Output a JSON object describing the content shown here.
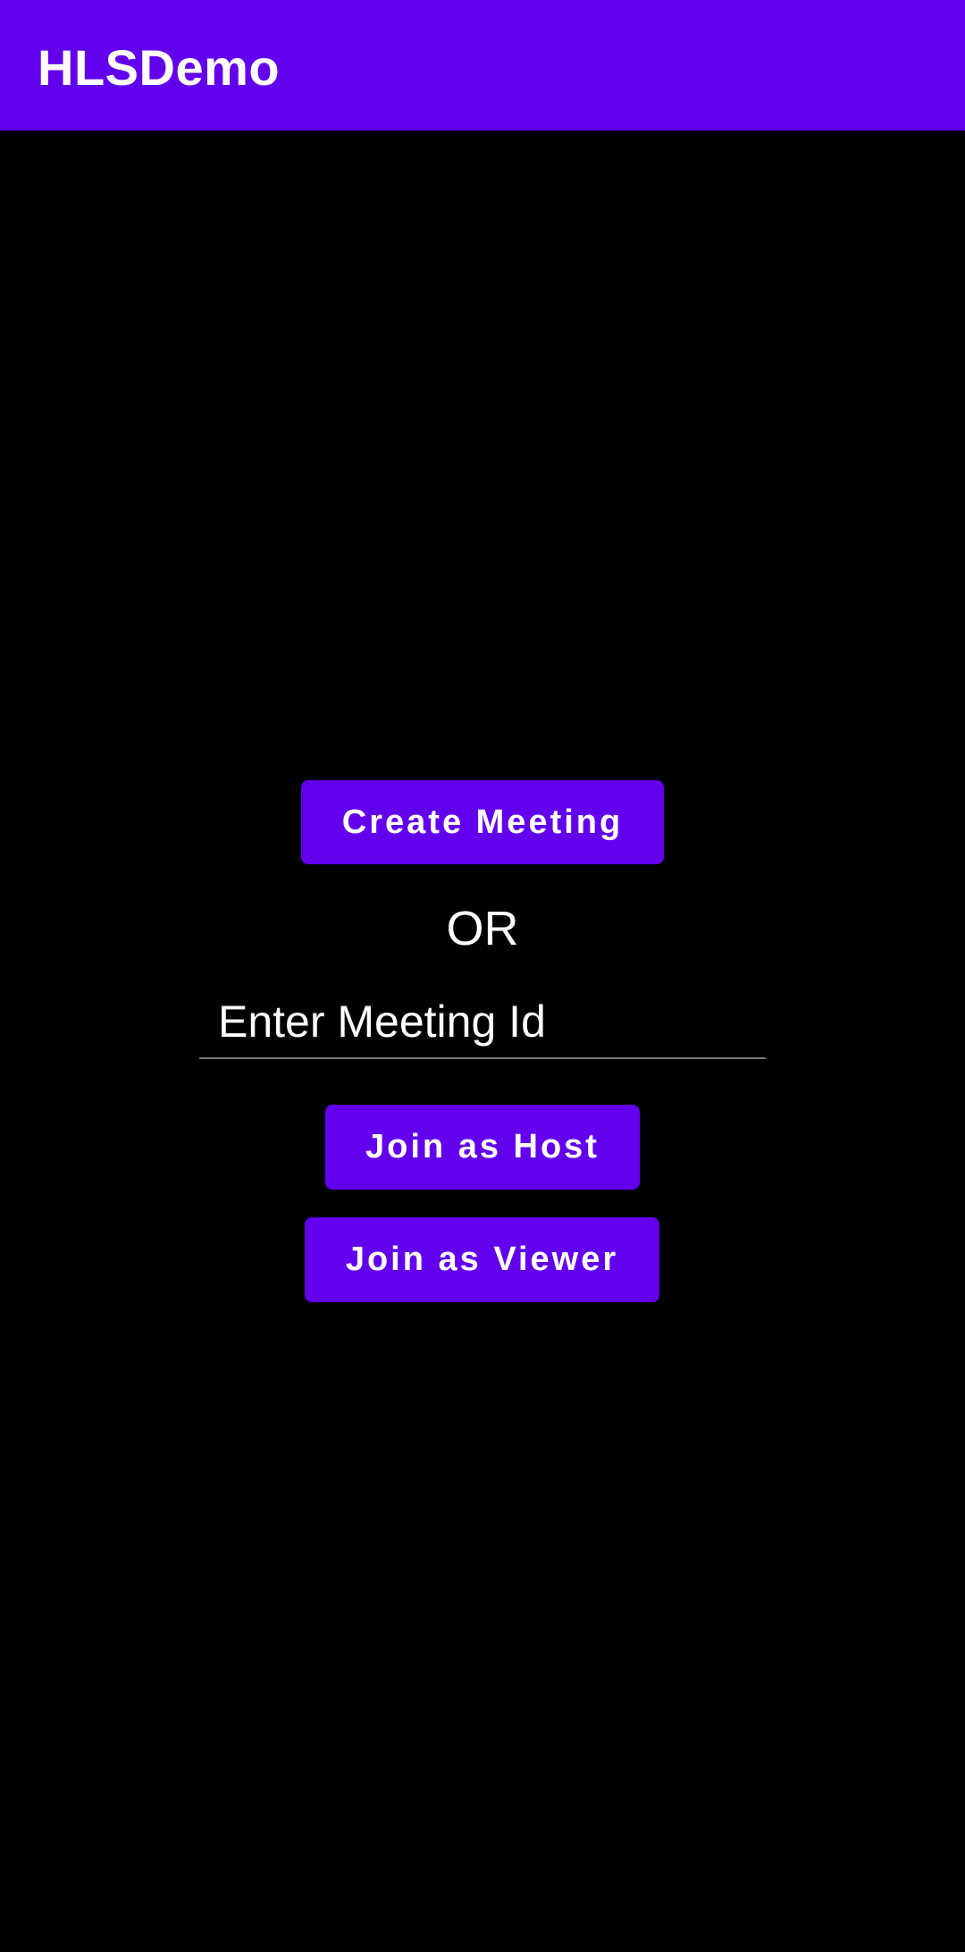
{
  "app_bar": {
    "title": "HLSDemo",
    "background": "#6200EE"
  },
  "main": {
    "create_meeting_label": "Create Meeting",
    "or_label": "OR",
    "meeting_id_input": {
      "value": "",
      "placeholder": "Enter Meeting Id"
    },
    "join_host_label": "Join as Host",
    "join_viewer_label": "Join as Viewer"
  },
  "colors": {
    "accent": "#6200EE",
    "background": "#000000",
    "text": "#FFFFFF"
  }
}
